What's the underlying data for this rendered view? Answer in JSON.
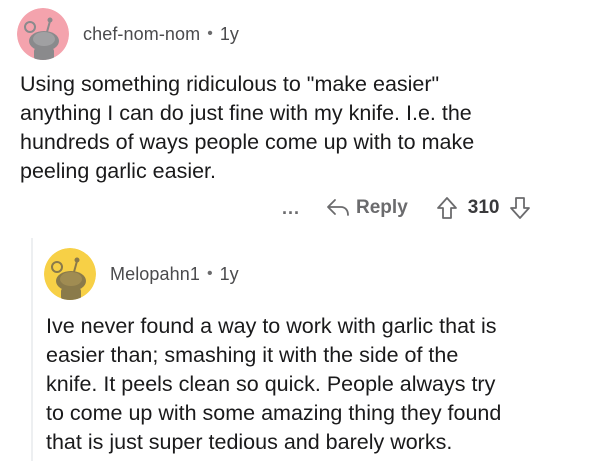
{
  "comments": [
    {
      "username": "chef-nom-nom",
      "separator": "•",
      "age": "1y",
      "body": "Using something ridiculous to \"make easier\"\nanything I can do just fine with my knife. I.e. the\nhundreds of ways people come up with to make\npeeling garlic easier.",
      "avatar_color": "#f4a3ad",
      "actions": {
        "more_label": "...",
        "reply_label": "Reply",
        "vote_count": "310"
      }
    },
    {
      "username": "Melopahn1",
      "separator": "•",
      "age": "1y",
      "body": "Ive never found a way to work with garlic that is\neasier than; smashing it with the side of the\nknife. It peels clean so quick. People always try\nto come up with some amazing thing they found\nthat is just super tedious and barely works.",
      "avatar_color": "#f7d046"
    }
  ],
  "icons": {
    "reply": "reply-arrow-icon",
    "upvote": "upvote-arrow-icon",
    "downvote": "downvote-arrow-icon",
    "more": "more-dots-icon"
  }
}
